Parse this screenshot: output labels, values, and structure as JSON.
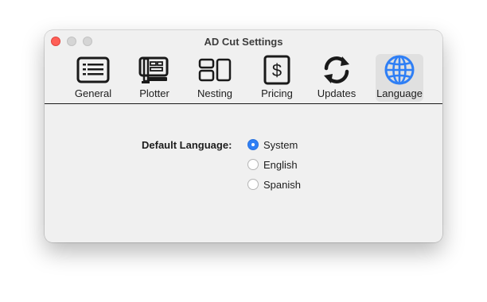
{
  "window": {
    "title": "AD Cut Settings"
  },
  "toolbar": {
    "tabs": [
      {
        "label": "General",
        "icon": "list-icon"
      },
      {
        "label": "Plotter",
        "icon": "plotter-icon"
      },
      {
        "label": "Nesting",
        "icon": "nesting-icon"
      },
      {
        "label": "Pricing",
        "icon": "dollar-icon"
      },
      {
        "label": "Updates",
        "icon": "sync-icon"
      },
      {
        "label": "Language",
        "icon": "globe-icon"
      }
    ],
    "selected": "Language"
  },
  "language": {
    "label": "Default Language:",
    "options": [
      "System",
      "English",
      "Spanish"
    ],
    "selected": "System"
  },
  "colors": {
    "accent": "#2f7ff5",
    "close": "#ff5f57"
  }
}
